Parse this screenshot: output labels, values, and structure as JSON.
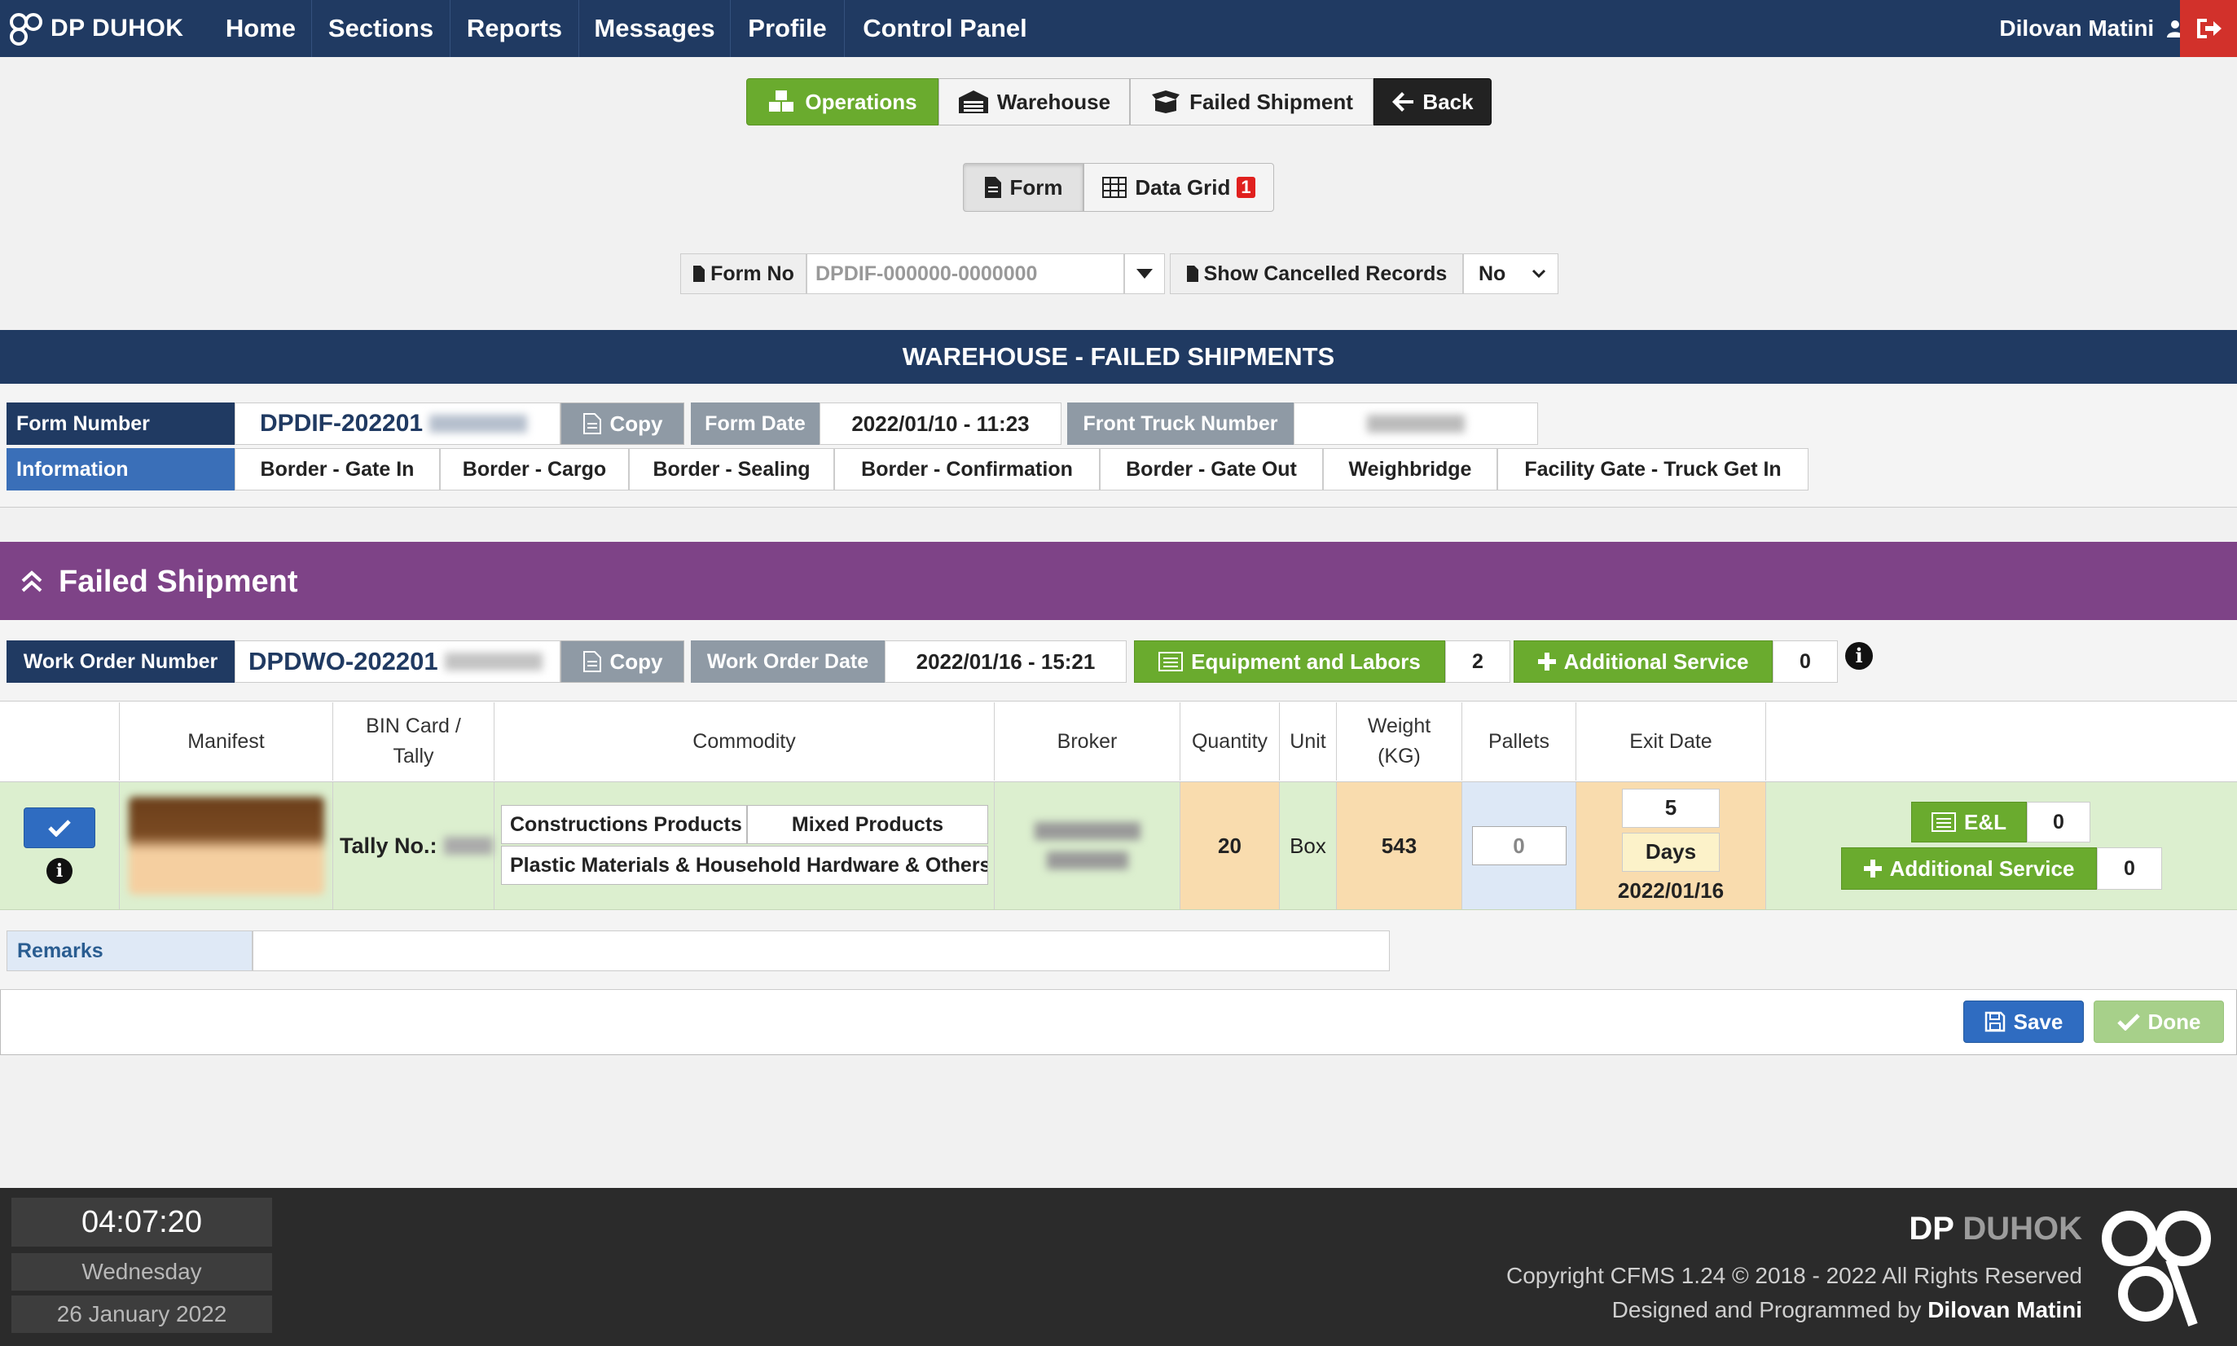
{
  "nav": {
    "brand": "DP DUHOK",
    "items": [
      "Home",
      "Sections",
      "Reports",
      "Messages",
      "Profile",
      "Control Panel"
    ],
    "user": "Dilovan Matini"
  },
  "toolbar": {
    "operations": "Operations",
    "warehouse": "Warehouse",
    "failed_shipment": "Failed Shipment",
    "back": "Back"
  },
  "view_tabs": {
    "form": "Form",
    "data_grid": "Data Grid",
    "data_grid_badge": "1"
  },
  "filters": {
    "form_no_label": "Form No",
    "form_no_placeholder": "DPDIF-000000-0000000",
    "show_cancelled_label": "Show Cancelled Records",
    "show_cancelled_value": "No"
  },
  "section_title": "WAREHOUSE - FAILED SHIPMENTS",
  "form_info": {
    "form_number_label": "Form Number",
    "form_number_value": "DPDIF-202201",
    "copy_label": "Copy",
    "form_date_label": "Form Date",
    "form_date_value": "2022/01/10 - 11:23",
    "front_truck_label": "Front Truck Number",
    "information_label": "Information",
    "info_tabs": [
      "Border - Gate In",
      "Border - Cargo",
      "Border - Sealing",
      "Border - Confirmation",
      "Border - Gate Out",
      "Weighbridge",
      "Facility Gate - Truck Get In"
    ]
  },
  "failed_shipment": {
    "title": "Failed Shipment",
    "work_order_label": "Work Order Number",
    "work_order_value": "DPDWO-202201",
    "copy_label": "Copy",
    "work_order_date_label": "Work Order Date",
    "work_order_date_value": "2022/01/16 - 15:21",
    "equipment_label": "Equipment and Labors",
    "equipment_count": "2",
    "additional_service_label": "Additional Service",
    "additional_service_count": "0"
  },
  "table": {
    "headers": {
      "manifest": "Manifest",
      "bin_card_1": "BIN Card /",
      "bin_card_2": "Tally",
      "commodity": "Commodity",
      "broker": "Broker",
      "quantity": "Quantity",
      "unit": "Unit",
      "weight_1": "Weight",
      "weight_2": "(KG)",
      "pallets": "Pallets",
      "exit_date": "Exit Date"
    },
    "row": {
      "tally": "Tally No.:",
      "commodity_1": "Constructions Products",
      "commodity_2": "Mixed Products",
      "commodity_3": "Plastic Materials & Household Hardware & Others",
      "quantity": "20",
      "unit": "Box",
      "weight": "543",
      "pallets": "0",
      "days_value": "5",
      "days_label": "Days",
      "exit_date": "2022/01/16",
      "el_label": "E&L",
      "el_count": "0",
      "additional_service_label": "Additional Service",
      "additional_service_count": "0"
    }
  },
  "remarks_label": "Remarks",
  "actions": {
    "save": "Save",
    "done": "Done"
  },
  "footer": {
    "time": "04:07:20",
    "day": "Wednesday",
    "date": "26 January 2022",
    "brand_dp": "DP",
    "brand_duhok": "DUHOK",
    "copyright": "Copyright CFMS 1.24 © 2018 - 2022 All Rights Reserved",
    "designed_prefix": "Designed and Programmed by",
    "designer": "Dilovan Matini"
  },
  "colors": {
    "navy": "#203a62",
    "green": "#6aab2e",
    "purple": "#7e4387",
    "red": "#d2312b",
    "info_blue": "#3a6fb8"
  }
}
